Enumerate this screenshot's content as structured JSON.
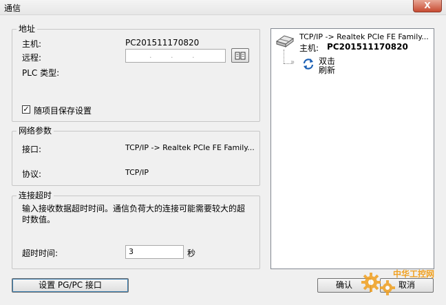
{
  "window": {
    "title": "通信",
    "close_label": "X"
  },
  "address": {
    "group_title": "地址",
    "host_label": "主机:",
    "host_value": "PC201511170820",
    "remote_label": "远程:",
    "remote_value": ". . .",
    "plc_type_label": "PLC 类型:",
    "save_with_project_label": "随项目保存设置",
    "save_with_project_checked": true
  },
  "network": {
    "group_title": "网络参数",
    "interface_label": "接口:",
    "interface_value": "TCP/IP -> Realtek PCIe FE Family...",
    "protocol_label": "协议:",
    "protocol_value": "TCP/IP"
  },
  "timeout": {
    "group_title": "连接超时",
    "description": "输入接收数据超时时间。通信负荷大的连接可能需要较大的超时数值。",
    "timeout_label": "超时时间:",
    "timeout_value": "3",
    "unit": "秒"
  },
  "tree": {
    "root_label": "TCP/IP -> Realtek PCIe FE Family...",
    "host_label": "主机:",
    "host_value": "PC201511170820",
    "child_line1": "双击",
    "child_line2": "刷新"
  },
  "buttons": {
    "set_pg_pc": "设置 PG/PC 接口",
    "ok": "确认",
    "cancel": "取消"
  },
  "watermark": {
    "text": "中华工控网"
  },
  "colors": {
    "refresh_icon": "#1a5fb4",
    "watermark": "#f0a020"
  }
}
